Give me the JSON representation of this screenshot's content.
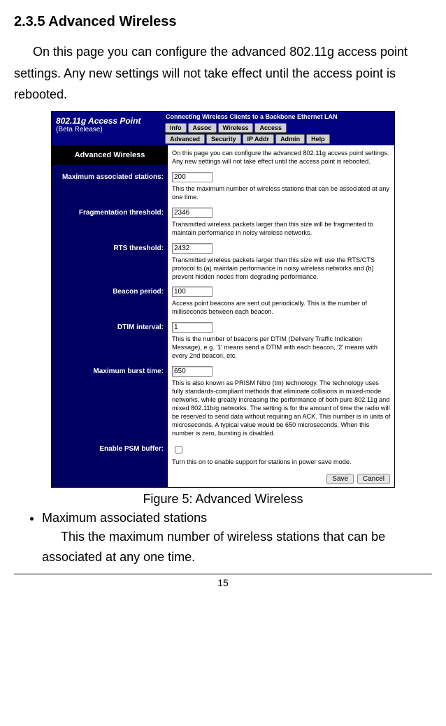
{
  "doc": {
    "heading": "2.3.5 Advanced Wireless",
    "intro": "On this page you can configure the advanced 802.11g access point settings. Any new settings will not take effect until the access point is rebooted.",
    "caption": "Figure 5: Advanced Wireless",
    "bullet": "Maximum associated stations",
    "bullet_desc": "This the maximum number of wireless stations that can be associated at any one time.",
    "pageno": "15"
  },
  "ui": {
    "ap_title": "802.11g Access Point",
    "ap_sub": "(Beta Release)",
    "connecting": "Connecting Wireless Clients to a Backbone Ethernet LAN",
    "tabs_row1": [
      "Info",
      "Assoc",
      "Wireless",
      "Access"
    ],
    "tabs_row2": [
      "Advanced",
      "Security",
      "IP Addr",
      "Admin",
      "Help"
    ],
    "panel_title": "Advanced Wireless",
    "top_desc": "On this page you can configure the advanced 802.11g access point settings. Any new settings will not take effect until the access point is rebooted.",
    "fields": {
      "max_stations": {
        "label": "Maximum associated stations:",
        "value": "200",
        "desc": "This the maximum number of wireless stations that can be associated at any one time."
      },
      "frag": {
        "label": "Fragmentation threshold:",
        "value": "2346",
        "desc": "Transmitted wireless packets larger than this size will be fragmented to maintain performance in noisy wireless networks."
      },
      "rts": {
        "label": "RTS threshold:",
        "value": "2432",
        "desc": "Transmitted wireless packets larger than this size will use the RTS/CTS protocol to (a) maintain performance in noisy wireless networks and (b) prevent hidden nodes from degrading performance."
      },
      "beacon": {
        "label": "Beacon period:",
        "value": "100",
        "desc": "Access point beacons are sent out periodically. This is the number of milliseconds between each beacon."
      },
      "dtim": {
        "label": "DTIM interval:",
        "value": "1",
        "desc": "This is the number of beacons per DTIM (Delivery Traffic Indication Message), e.g. '1' means send a DTIM with each beacon, '2' means with every 2nd beacon, etc."
      },
      "burst": {
        "label": "Maximum burst time:",
        "value": "650",
        "desc": "This is also known as PRISM Nitro (tm) technology. The technology uses fully standards-compliant methods that eliminate collisions in mixed-mode networks, while greatly increasing the performance of both pure 802.11g and mixed 802.11b/g networks. The setting is for the amount of time the radio will be reserved to send data without requiring an ACK. This number is in units of microseconds. A typical value would be 650 microseconds. When this number is zero, bursting is disabled."
      },
      "psm": {
        "label": "Enable PSM buffer:",
        "desc": "Turn this on to enable support for stations in power save mode."
      }
    },
    "buttons": {
      "save": "Save",
      "cancel": "Cancel"
    }
  }
}
